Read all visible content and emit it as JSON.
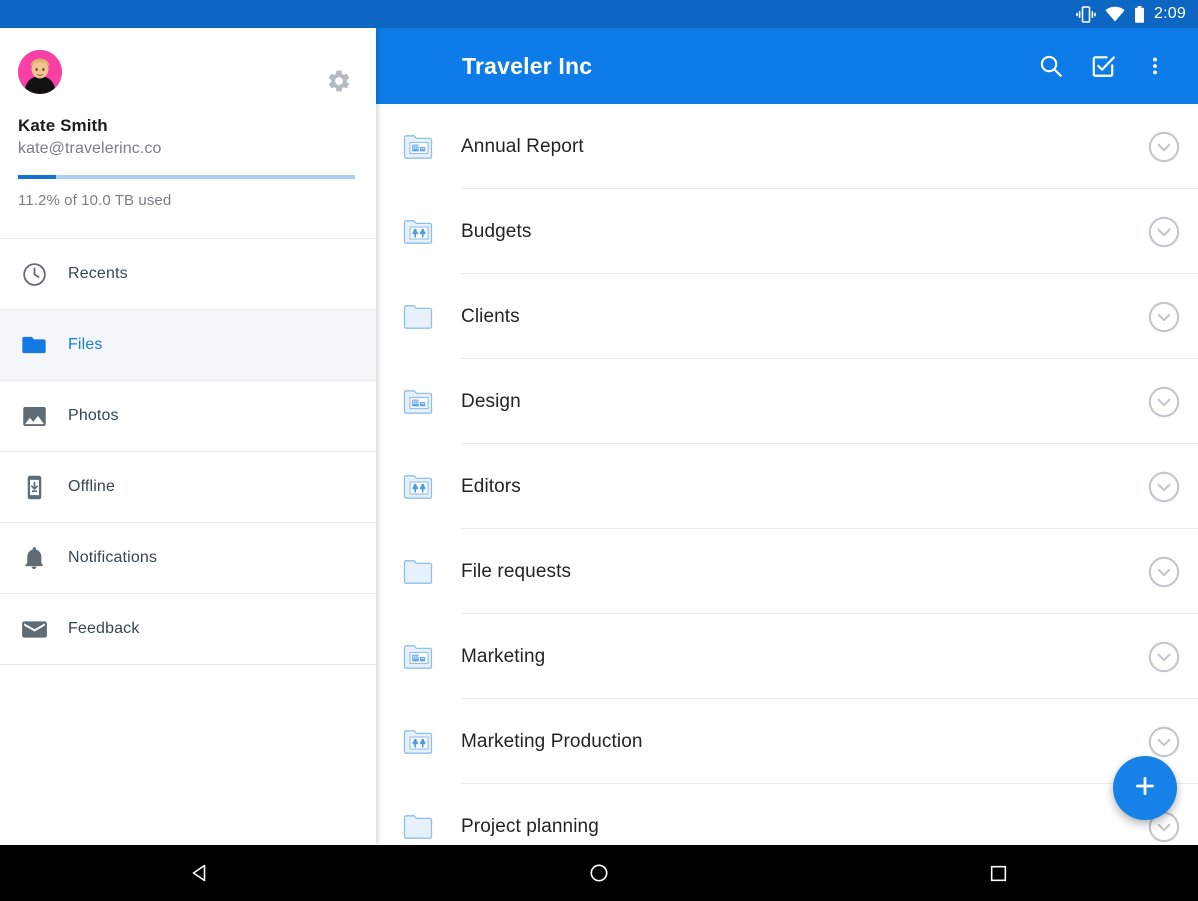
{
  "status_bar": {
    "time": "2:09",
    "icons": [
      "vibrate-icon",
      "wifi-icon",
      "battery-icon"
    ]
  },
  "drawer": {
    "account": {
      "name": "Kate Smith",
      "email": "kate@travelerinc.co",
      "quota_label": "11.2% of 10.0 TB used",
      "quota_percent": 11.2,
      "avatar_name": "avatar",
      "settings_icon": "gear-icon"
    },
    "items": [
      {
        "label": "Recents",
        "icon": "clock-icon",
        "active": false
      },
      {
        "label": "Files",
        "icon": "folder-icon",
        "active": true
      },
      {
        "label": "Photos",
        "icon": "photo-icon",
        "active": false
      },
      {
        "label": "Offline",
        "icon": "offline-phone-icon",
        "active": false
      },
      {
        "label": "Notifications",
        "icon": "bell-icon",
        "active": false
      },
      {
        "label": "Feedback",
        "icon": "mail-icon",
        "active": false
      }
    ]
  },
  "appbar": {
    "title": "Traveler Inc",
    "actions": [
      {
        "name": "search-icon",
        "label": "Search"
      },
      {
        "name": "select-check-icon",
        "label": "Select"
      },
      {
        "name": "overflow-menu-icon",
        "label": "More options"
      }
    ]
  },
  "files": {
    "rows": [
      {
        "name": "Annual Report",
        "icon": "team-folder-icon",
        "chevron": "chevron-down-icon"
      },
      {
        "name": "Budgets",
        "icon": "shared-folder-icon",
        "chevron": "chevron-down-icon"
      },
      {
        "name": "Clients",
        "icon": "folder-icon",
        "chevron": "chevron-down-icon"
      },
      {
        "name": "Design",
        "icon": "team-folder-icon",
        "chevron": "chevron-down-icon"
      },
      {
        "name": "Editors",
        "icon": "shared-folder-icon",
        "chevron": "chevron-down-icon"
      },
      {
        "name": "File requests",
        "icon": "folder-icon",
        "chevron": "chevron-down-icon"
      },
      {
        "name": "Marketing",
        "icon": "team-folder-icon",
        "chevron": "chevron-down-icon"
      },
      {
        "name": "Marketing Production",
        "icon": "shared-folder-icon",
        "chevron": "chevron-down-icon"
      },
      {
        "name": "Project planning",
        "icon": "folder-icon",
        "chevron": "chevron-down-icon"
      }
    ]
  },
  "fab": {
    "label": "+",
    "icon": "plus-icon"
  },
  "android_nav": {
    "back": "back-triangle-icon",
    "home": "home-circle-icon",
    "recents": "recents-square-icon"
  },
  "colors": {
    "status_bar": "#0d66c2",
    "app_bar": "#0d7ce8",
    "accent": "#1a7ee8",
    "fab": "#1681e6",
    "folder_outline": "#8fc0ea",
    "folder_fill": "#eaf3fc",
    "avatar_bg": "#f73fa5"
  }
}
